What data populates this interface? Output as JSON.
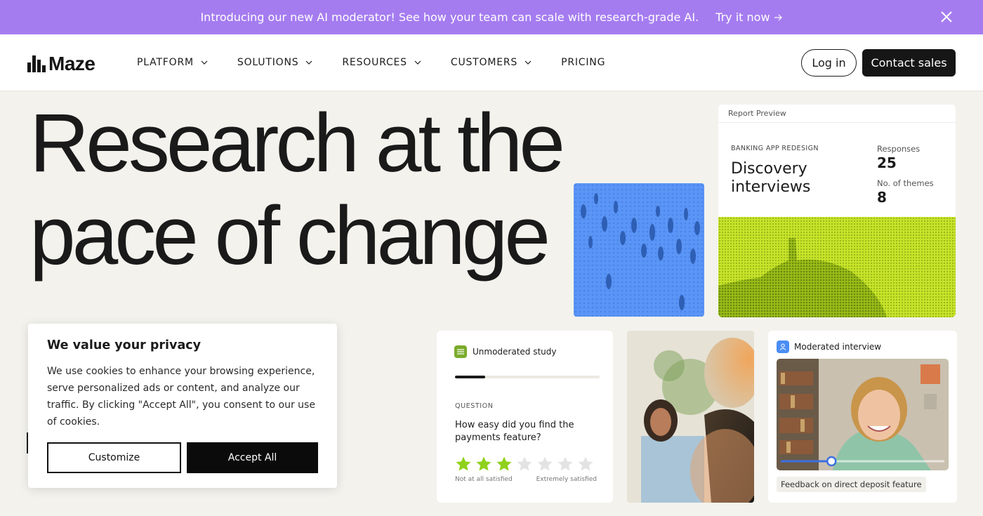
{
  "banner": {
    "message": "Introducing our new AI moderator! See how your team can scale with research-grade AI.",
    "cta": "Try it now",
    "background": "#a57cf0"
  },
  "nav": {
    "logo": "Maze",
    "items": [
      {
        "label": "PLATFORM",
        "dropdown": true
      },
      {
        "label": "SOLUTIONS",
        "dropdown": true
      },
      {
        "label": "RESOURCES",
        "dropdown": true
      },
      {
        "label": "CUSTOMERS",
        "dropdown": true
      },
      {
        "label": "PRICING",
        "dropdown": false
      }
    ],
    "login": "Log in",
    "contact": "Contact sales"
  },
  "hero": {
    "line1": "Research at the",
    "line2": "pace of change"
  },
  "report": {
    "header": "Report Preview",
    "eyebrow": "BANKING APP REDESIGN",
    "title": "Discovery interviews",
    "responses_label": "Responses",
    "responses_value": "25",
    "themes_label": "No. of themes",
    "themes_value": "8",
    "accent": "#c7e32a"
  },
  "unmoderated": {
    "tag": "Unmoderated study",
    "progress": 0.21,
    "question_label": "QUESTION",
    "question": "How easy did you find the payments feature?",
    "rating": 3,
    "rating_max": 7,
    "scale_low": "Not at all satisfied",
    "scale_high": "Extremely satisfied",
    "star_color": "#8fd11c"
  },
  "moderated": {
    "tag": "Moderated interview",
    "caption": "Feedback on direct deposit feature",
    "video_progress": 0.31
  },
  "cookie": {
    "title": "We value your privacy",
    "body": "We use cookies to enhance your browsing experience, serve personalized ads or content, and analyze our traffic. By clicking \"Accept All\", you consent to our use of cookies.",
    "customize": "Customize",
    "accept": "Accept All"
  }
}
